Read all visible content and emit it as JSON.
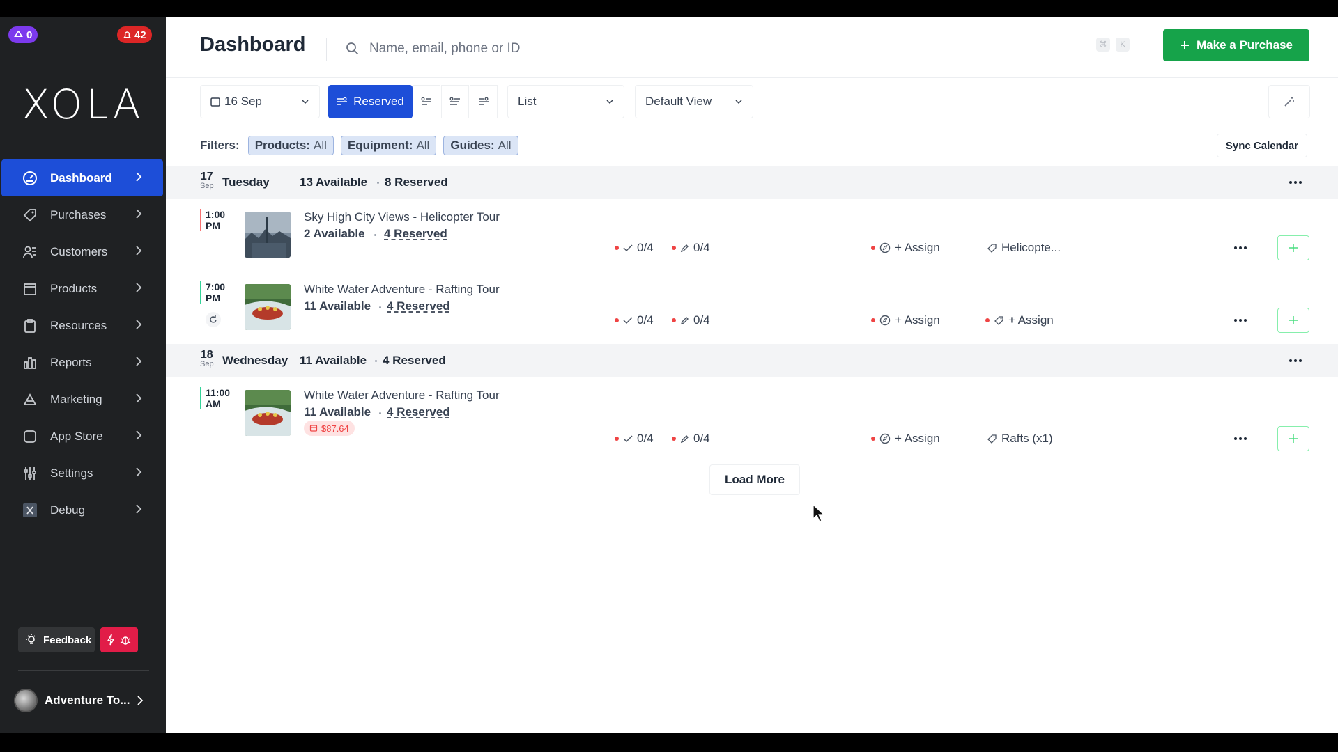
{
  "badges": {
    "left_count": "0",
    "right_count": "42"
  },
  "brand": {
    "logo": "XOLA"
  },
  "sidebar": {
    "items": [
      {
        "label": "Dashboard",
        "icon": "dashboard-icon",
        "active": true
      },
      {
        "label": "Purchases",
        "icon": "tag-icon"
      },
      {
        "label": "Customers",
        "icon": "users-icon"
      },
      {
        "label": "Products",
        "icon": "box-icon"
      },
      {
        "label": "Resources",
        "icon": "clipboard-icon"
      },
      {
        "label": "Reports",
        "icon": "bar-chart-icon"
      },
      {
        "label": "Marketing",
        "icon": "megaphone-icon"
      },
      {
        "label": "App Store",
        "icon": "square-icon"
      },
      {
        "label": "Settings",
        "icon": "sliders-icon"
      },
      {
        "label": "Debug",
        "icon": "x-box-icon"
      }
    ],
    "feedback_label": "Feedback",
    "account_name": "Adventure To..."
  },
  "header": {
    "title": "Dashboard",
    "search_placeholder": "Name, email, phone or ID",
    "kbd_1": "⌘",
    "kbd_2": "K",
    "purchase_label": "Make a Purchase"
  },
  "toolbar": {
    "date": "16 Sep",
    "reserved_label": "Reserved",
    "view_mode": "List",
    "saved_view": "Default View"
  },
  "filters": {
    "label": "Filters:",
    "chips": [
      {
        "key": "Products:",
        "value": "All"
      },
      {
        "key": "Equipment:",
        "value": "All"
      },
      {
        "key": "Guides:",
        "value": "All"
      }
    ],
    "sync_label": "Sync Calendar"
  },
  "days": [
    {
      "day": "17",
      "month": "Sep",
      "name": "Tuesday",
      "available": "13 Available",
      "reserved": "8 Reserved"
    },
    {
      "day": "18",
      "month": "Sep",
      "name": "Wednesday",
      "available": "11 Available",
      "reserved": "4 Reserved"
    }
  ],
  "events": [
    {
      "time_1": "1:00",
      "time_2": "PM",
      "title": "Sky High City Views - Helicopter Tour",
      "available": "2 Available",
      "reserved": "4 Reserved",
      "checked_in": "0/4",
      "waivers": "0/4",
      "guide": "+ Assign",
      "equipment": "Helicopte..."
    },
    {
      "time_1": "7:00",
      "time_2": "PM",
      "title": "White Water Adventure - Rafting Tour",
      "available": "11 Available",
      "reserved": "4 Reserved",
      "checked_in": "0/4",
      "waivers": "0/4",
      "guide": "+ Assign",
      "equipment": "+ Assign"
    },
    {
      "time_1": "11:00",
      "time_2": "AM",
      "title": "White Water Adventure - Rafting Tour",
      "available": "11 Available",
      "reserved": "4 Reserved",
      "checked_in": "0/4",
      "waivers": "0/4",
      "guide": "+ Assign",
      "equipment": "Rafts (x1)",
      "price": "$87.64"
    }
  ],
  "load_more": "Load More",
  "colors": {
    "primary": "#1d4ed8",
    "success": "#16a34a",
    "danger": "#ef4444",
    "sidebar": "#1f2123"
  }
}
